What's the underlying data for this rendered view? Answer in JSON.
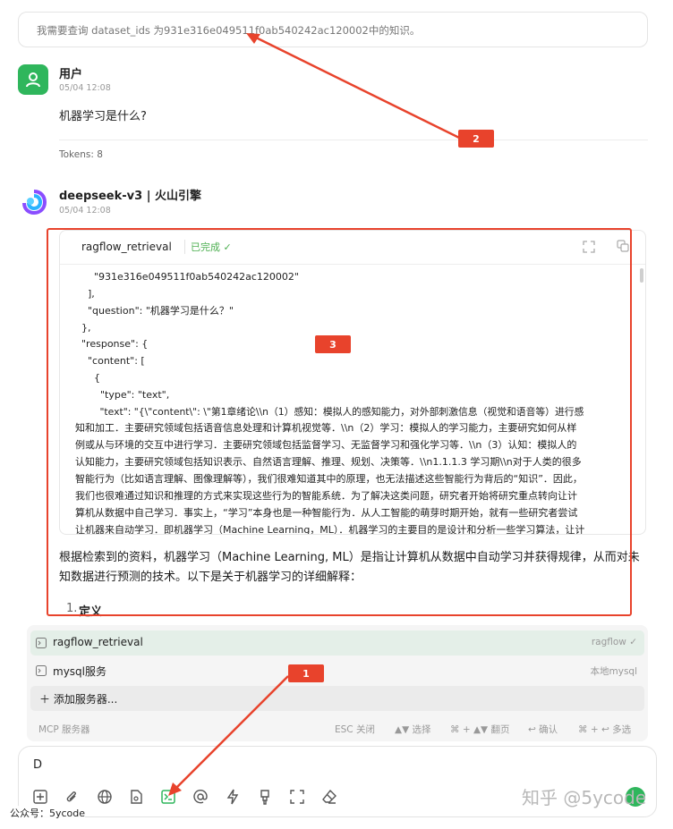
{
  "system_message": "我需要查询 dataset_ids 为931e316e049511f0ab540242ac120002中的知识。",
  "user": {
    "name": "用户",
    "time": "05/04 12:08",
    "text": "机器学习是什么?",
    "tokens": "Tokens: 8"
  },
  "assistant": {
    "name": "deepseek-v3 | 火山引擎",
    "time": "05/04 12:08",
    "tool": {
      "name": "ragflow_retrieval",
      "status": "已完成 ✓",
      "code_lines": [
        "      \"931e316e049511f0ab540242ac120002\"",
        "    ],",
        "    \"question\": \"机器学习是什么？\"",
        "  },",
        "  \"response\": {",
        "    \"content\": [",
        "      {",
        "        \"type\": \"text\","
      ],
      "text_line": "        \"text\": \"{\\\"content\\\": \\\"第1章绪论\\\\n（1）感知：模拟人的感知能力，对外部刺激信息（视觉和语音等）进行感",
      "wrapped_lines": [
        "知和加工．主要研究领域包括语音信息处理和计算机视觉等．\\\\n（2）学习：模拟人的学习能力，主要研究如何从样",
        "例或从与环境的交互中进行学习．主要研究领域包括监督学习、无监督学习和强化学习等．\\\\n（3）认知：模拟人的",
        "认知能力，主要研究领域包括知识表示、自然语言理解、推理、规划、决策等．\\\\n1.1.1.3 学习期\\\\n对于人类的很多",
        "智能行为（比如语言理解、图像理解等），我们很难知道其中的原理，也无法描述这些智能行为背后的“知识”．因此，",
        "我们也很难通过知识和推理的方式来实现这些行为的智能系统．为了解决这类问题，研究者开始将研究重点转向让计",
        "算机从数据中自己学习．事实上，“学习”本身也是一种智能行为．从人工智能的萌芽时期开始，就有一些研究者尝试",
        "让机器来自动学习．即机器学习（Machine Learning，ML）．机器学习的主要目的是设计和分析一些学习算法，让计"
      ]
    },
    "answer": "根据检索到的资料，机器学习（Machine Learning, ML）是指让计算机从数据中自动学习并获得规律，从而对未知数据进行预测的技术。以下是关于机器学习的详细解释：",
    "list_number": "1.",
    "list_item": "定义"
  },
  "annotations": {
    "badge_1": "1",
    "badge_2": "2",
    "badge_3": "3",
    "accent": "#e8432c"
  },
  "mcp_popup": {
    "items": [
      {
        "label": "ragflow_retrieval",
        "meta": "ragflow ✓"
      },
      {
        "label": "mysql服务",
        "meta": "本地mysql"
      },
      {
        "label": "＋ 添加服务器..."
      }
    ],
    "footer_title": "MCP 服务器",
    "hints": [
      "ESC 关闭",
      "▲▼ 选择",
      "⌘ + ▲▼ 翻页",
      "↩ 确认",
      "⌘ + ↩ 多选"
    ]
  },
  "input": {
    "value": "D"
  },
  "toolbar_icons": [
    "new-topic-icon",
    "attachment-icon",
    "web-search-icon",
    "knowledge-base-icon",
    "mcp-server-icon",
    "mention-icon",
    "quick-phrase-icon",
    "clear-format-icon",
    "expand-icon",
    "eraser-icon"
  ],
  "watermark": "知乎 @5ycode",
  "footer_label": "公众号：5ycode",
  "brand_green": "#2fb65c"
}
